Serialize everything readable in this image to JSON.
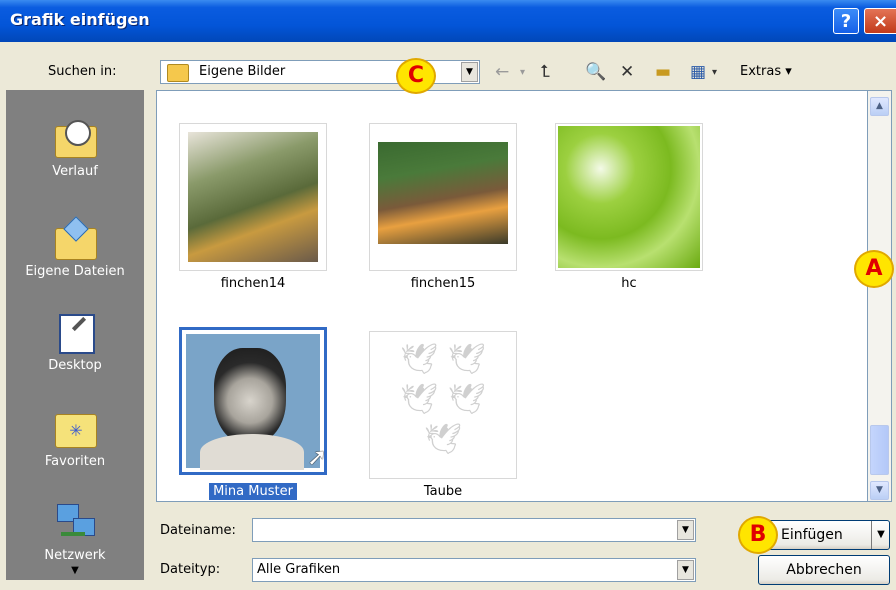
{
  "window": {
    "title": "Grafik einfügen",
    "help_label": "?",
    "close_label": "×"
  },
  "toolbar": {
    "look_in_label": "Suchen in:",
    "look_in_value": "Eigene Bilder",
    "extras_label": "Extras",
    "tools": [
      "back-icon",
      "up-folder-icon",
      "search-web-icon",
      "delete-icon",
      "new-folder-icon",
      "views-icon"
    ]
  },
  "places": [
    {
      "label": "Verlauf",
      "icon": "history-icon"
    },
    {
      "label": "Eigene Dateien",
      "icon": "my-documents-icon"
    },
    {
      "label": "Desktop",
      "icon": "desktop-icon"
    },
    {
      "label": "Favoriten",
      "icon": "favorites-icon"
    },
    {
      "label": "Netzwerk",
      "icon": "network-icon"
    }
  ],
  "files": [
    {
      "name": "finchen14"
    },
    {
      "name": "finchen15"
    },
    {
      "name": "hc"
    },
    {
      "name": "Mina Muster",
      "selected": true
    },
    {
      "name": "Taube"
    }
  ],
  "filename": {
    "label": "Dateiname:",
    "value": ""
  },
  "filetype": {
    "label": "Dateityp:",
    "value": "Alle Grafiken"
  },
  "buttons": {
    "insert": "Einfügen",
    "cancel": "Abbrechen"
  },
  "markers": {
    "a": "A",
    "b": "B",
    "c": "C"
  },
  "colors": {
    "title_bar": "#0355D8",
    "places_bar": "#808080",
    "selection": "#316AC5",
    "marker_fill": "#FFE500",
    "marker_text": "#E00000"
  }
}
